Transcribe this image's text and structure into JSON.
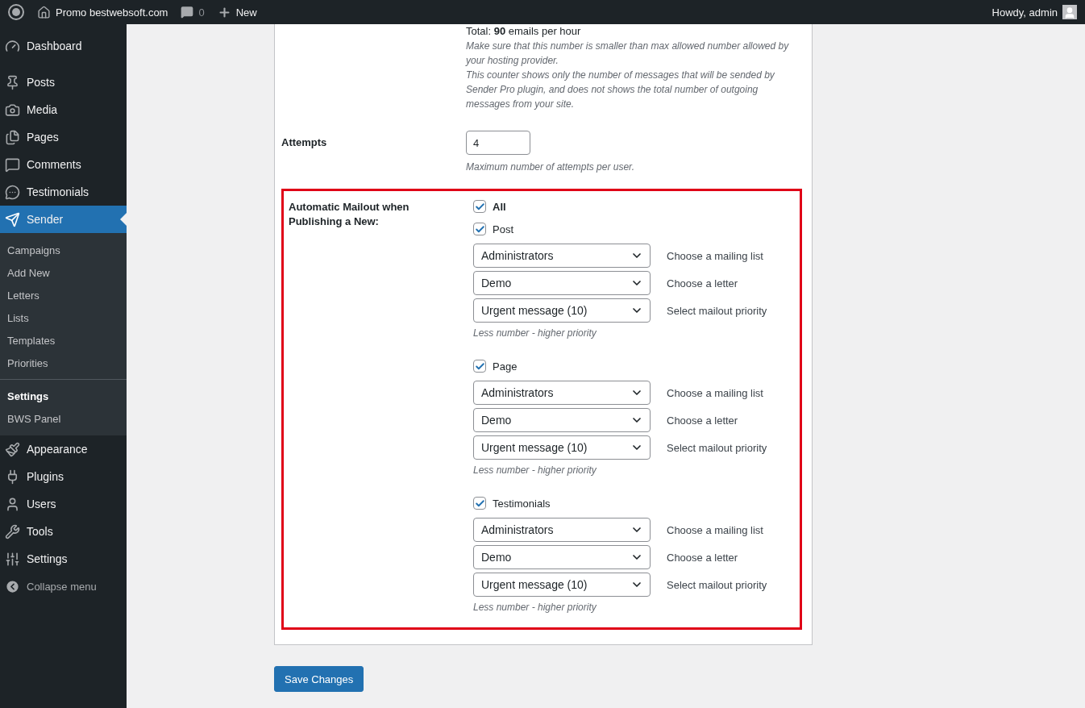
{
  "topbar": {
    "site": "Promo bestwebsoft.com",
    "comments": "0",
    "new": "New",
    "greeting": "Howdy, admin"
  },
  "sidebar": {
    "items": [
      {
        "label": "Dashboard",
        "selected": false
      },
      {
        "label": "Posts",
        "selected": false
      },
      {
        "label": "Media",
        "selected": false
      },
      {
        "label": "Pages",
        "selected": false
      },
      {
        "label": "Comments",
        "selected": false
      },
      {
        "label": "Testimonials",
        "selected": false
      },
      {
        "label": "Sender",
        "selected": true,
        "children": [
          {
            "label": "Campaigns",
            "selected": false
          },
          {
            "label": "Add New",
            "selected": false
          },
          {
            "label": "Letters",
            "selected": false
          },
          {
            "label": "Lists",
            "selected": false
          },
          {
            "label": "Templates",
            "selected": false
          },
          {
            "label": "Priorities",
            "selected": false
          },
          {
            "label": "Settings",
            "selected": true,
            "divider": true
          },
          {
            "label": "BWS Panel",
            "selected": false
          }
        ]
      },
      {
        "label": "Appearance",
        "selected": false
      },
      {
        "label": "Plugins",
        "selected": false
      },
      {
        "label": "Users",
        "selected": false
      },
      {
        "label": "Tools",
        "selected": false
      },
      {
        "label": "Settings",
        "selected": false
      }
    ],
    "collapse": "Collapse menu"
  },
  "rate": {
    "total": "Total: **90** emails per hour",
    "notes": [
      "Make sure that this number is smaller than max allowed number allowed by your hosting provider.",
      "This counter shows only the number of messages that will be sended by Sender Pro plugin, and does not shows the total number of outgoing messages from your site."
    ]
  },
  "attempts": {
    "label": "Attempts",
    "value": "4",
    "description": "Maximum number of attempts per user."
  },
  "mailout": {
    "label": "Automatic Mailout when Publishing a New:",
    "all": {
      "label": "All",
      "checked": true
    },
    "groups": [
      {
        "label": "Post",
        "checked": true,
        "selects": [
          {
            "value": "Administrators",
            "hint": "Choose a mailing list"
          },
          {
            "value": "Demo",
            "hint": "Choose a letter"
          },
          {
            "value": "Urgent message (10)",
            "hint": "Select mailout priority"
          }
        ],
        "description": "Less number - higher priority"
      },
      {
        "label": "Page",
        "checked": true,
        "selects": [
          {
            "value": "Administrators",
            "hint": "Choose a mailing list"
          },
          {
            "value": "Demo",
            "hint": "Choose a letter"
          },
          {
            "value": "Urgent message (10)",
            "hint": "Select mailout priority"
          }
        ],
        "description": "Less number - higher priority"
      },
      {
        "label": "Testimonials",
        "checked": true,
        "selects": [
          {
            "value": "Administrators",
            "hint": "Choose a mailing list"
          },
          {
            "value": "Demo",
            "hint": "Choose a letter"
          },
          {
            "value": "Urgent message (10)",
            "hint": "Select mailout priority"
          }
        ],
        "description": "Less number - higher priority"
      }
    ]
  },
  "save": "Save Changes"
}
